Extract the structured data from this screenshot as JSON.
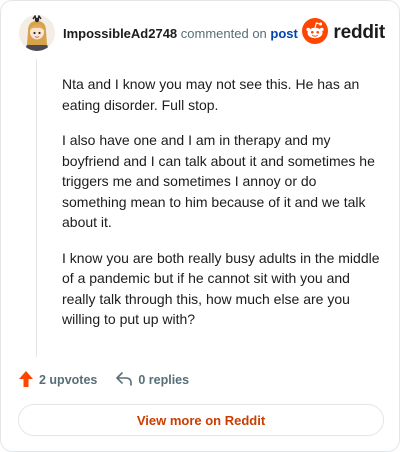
{
  "header": {
    "username": "ImpossibleAd2748",
    "commented_on": "commented on",
    "post_link": "post",
    "brand": "reddit"
  },
  "comment": {
    "paragraphs": [
      "Nta and I know you may not see this. He has an eating disorder. Full stop.",
      "I also have one and I am in therapy and my boyfriend and I can talk about it and sometimes he triggers me and sometimes I annoy or do something mean to him because of it and we talk about it.",
      "I know you are both really busy adults in the middle of a pandemic but if he cannot sit with you and really talk through this, how much else are you willing to put up with?"
    ]
  },
  "actions": {
    "upvotes": "2 upvotes",
    "replies": "0 replies"
  },
  "footer": {
    "view_more": "View more on Reddit"
  },
  "colors": {
    "accent": "#ff4500",
    "link": "#0045ac",
    "view_more": "#c93d00"
  },
  "icons": {
    "avatar": "avatar",
    "logo": "reddit-snoo-icon",
    "upvote": "upvote-arrow-icon",
    "reply": "reply-arrow-icon"
  }
}
